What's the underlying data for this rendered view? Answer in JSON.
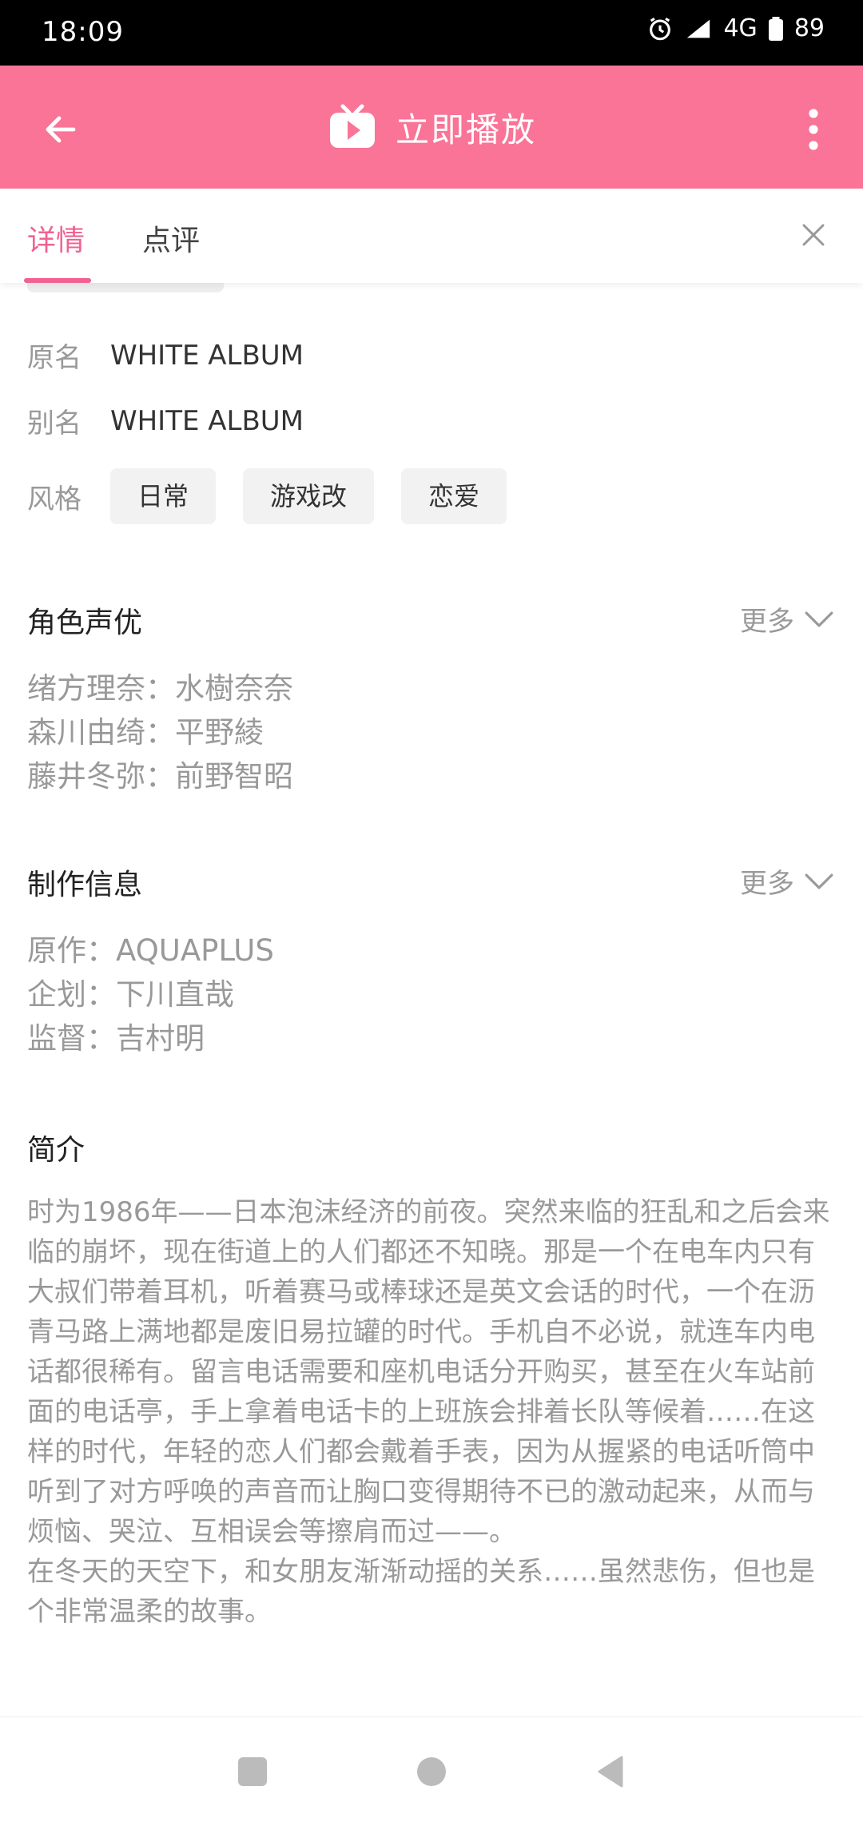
{
  "status_bar": {
    "time": "18:09",
    "network": "4G",
    "battery": "89"
  },
  "app_bar": {
    "title": "立即播放",
    "icons": [
      "back-arrow-icon",
      "tv-play-icon",
      "more-vert-icon"
    ]
  },
  "tabs": [
    {
      "label": "详情",
      "active": true
    },
    {
      "label": "点评",
      "active": false
    }
  ],
  "info": {
    "original_name_label": "原名",
    "original_name_value": "WHITE ALBUM",
    "alias_label": "别名",
    "alias_value": "WHITE ALBUM",
    "style_label": "风格",
    "styles": [
      "日常",
      "游戏改",
      "恋爱"
    ]
  },
  "cast_section": {
    "title": "角色声优",
    "more_label": "更多",
    "items": [
      "绪方理奈：水樹奈奈",
      "森川由绮：平野綾",
      "藤井冬弥：前野智昭"
    ]
  },
  "production_section": {
    "title": "制作信息",
    "more_label": "更多",
    "items": [
      "原作：AQUAPLUS",
      "企划：下川直哉",
      "监督：吉村明"
    ]
  },
  "synopsis_section": {
    "title": "简介",
    "text": "时为1986年——日本泡沫经济的前夜。突然来临的狂乱和之后会来临的崩坏，现在街道上的人们都还不知晓。那是一个在电车内只有大叔们带着耳机，听着赛马或棒球还是英文会话的时代，一个在沥青马路上满地都是废旧易拉罐的时代。手机自不必说，就连车内电话都很稀有。留言电话需要和座机电话分开购买，甚至在火车站前面的电话亭，手上拿着电话卡的上班族会排着长队等候着……在这样的时代，年轻的恋人们都会戴着手表，因为从握紧的电话听筒中听到了对方呼唤的声音而让胸口变得期待不已的激动起来，从而与烦恼、哭泣、互相误会等擦肩而过——。",
    "text2": "在冬天的天空下，和女朋友渐渐动摇的关系……虽然悲伤，但也是个非常温柔的故事。"
  },
  "colors": {
    "accent": "#f97497",
    "tab_active": "#f06292"
  }
}
